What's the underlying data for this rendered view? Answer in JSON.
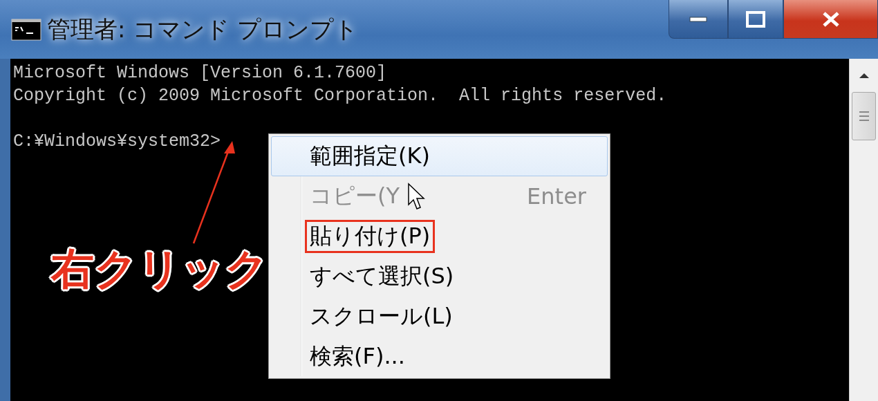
{
  "window": {
    "title": "管理者: コマンド プロンプト"
  },
  "console": {
    "output": [
      "Microsoft Windows [Version 6.1.7600]",
      "Copyright (c) 2009 Microsoft Corporation.  All rights reserved."
    ],
    "prompt": "C:¥Windows¥system32>"
  },
  "context_menu": {
    "items": [
      {
        "label": "範囲指定(K)",
        "disabled": false,
        "hovered": true,
        "annotated": false
      },
      {
        "label": "コピー(Y",
        "shortcut": "Enter",
        "disabled": true,
        "hovered": false,
        "annotated": false
      },
      {
        "label": "貼り付け(P)",
        "disabled": false,
        "hovered": false,
        "annotated": true
      },
      {
        "label": "すべて選択(S)",
        "disabled": false,
        "hovered": false,
        "annotated": false
      },
      {
        "label": "スクロール(L)",
        "disabled": false,
        "hovered": false,
        "annotated": false
      },
      {
        "label": "検索(F)...",
        "disabled": false,
        "hovered": false,
        "annotated": false
      }
    ]
  },
  "annotation": {
    "text": "右クリック"
  }
}
